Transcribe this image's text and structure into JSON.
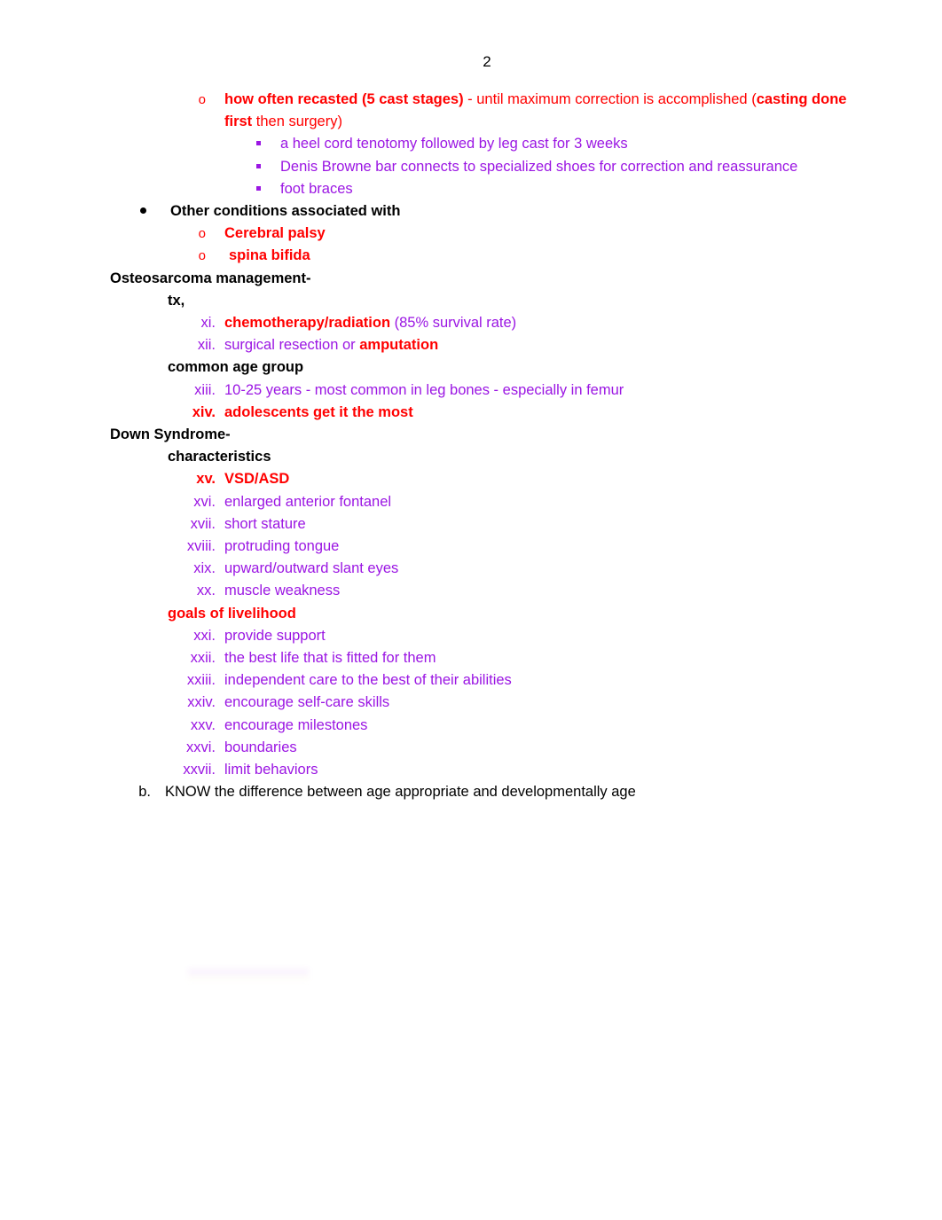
{
  "document": {
    "page_number": "2",
    "colors": {
      "red": "#ff0000",
      "purple": "#9b16e3",
      "black": "#000000"
    }
  },
  "markers": {
    "circle": "o",
    "letter_b": "b."
  },
  "blocks": {
    "recast": {
      "marker": "o",
      "bold_lead": "how often recasted (5 cast stages)",
      "mid": " - until maximum correction is accomplished (",
      "bold_tail": "casting done first",
      "end": " then surgery)"
    },
    "recast_sub": [
      {
        "text": "a heel cord tenotomy followed by leg cast for 3 weeks"
      },
      {
        "text": "Denis Browne bar connects to specialized shoes for correction and reassurance"
      },
      {
        "text": "foot braces"
      }
    ],
    "other_conditions": {
      "heading": "Other conditions associated with",
      "items": [
        {
          "marker": "o",
          "text": "Cerebral palsy"
        },
        {
          "marker": "o",
          "text": "spina bifida"
        }
      ]
    },
    "osteosarcoma": {
      "heading": "Osteosarcoma management-",
      "subhead_tx": "tx,",
      "tx_items": [
        {
          "numeral": "xi.",
          "bold_part": "chemotherapy/radiation",
          "plain_part": " (85% survival rate)"
        },
        {
          "numeral": "xii.",
          "plain_lead": "surgical resection or ",
          "bold_tail": "amputation"
        }
      ],
      "subhead_age": "common age group",
      "age_items": [
        {
          "numeral": "xiii.",
          "text": "10-25 years - most common in leg bones - especially in femur",
          "style": "purple"
        },
        {
          "numeral": "xiv.",
          "text": "adolescents get it the most",
          "style": "red-bold"
        }
      ]
    },
    "down_syndrome": {
      "heading": "Down Syndrome-",
      "subhead_characteristics": "characteristics",
      "characteristics": [
        {
          "numeral": "xv.",
          "text": "VSD/ASD",
          "style": "red-bold"
        },
        {
          "numeral": "xvi.",
          "text": "enlarged anterior fontanel",
          "style": "purple"
        },
        {
          "numeral": "xvii.",
          "text": "short stature",
          "style": "purple"
        },
        {
          "numeral": "xviii.",
          "text": "protruding tongue",
          "style": "purple"
        },
        {
          "numeral": "xix.",
          "text": "upward/outward slant eyes",
          "style": "purple"
        },
        {
          "numeral": "xx.",
          "text": "muscle weakness",
          "style": "purple"
        }
      ],
      "subhead_goals": "goals of livelihood",
      "goals": [
        {
          "numeral": "xxi.",
          "text": "provide support",
          "style": "purple"
        },
        {
          "numeral": "xxii.",
          "text": "the best life that is fitted for them",
          "style": "purple"
        },
        {
          "numeral": "xxiii.",
          "text": "independent care to the best of their abilities",
          "style": "purple"
        },
        {
          "numeral": "xxiv.",
          "text": "encourage self-care skills",
          "style": "purple"
        },
        {
          "numeral": "xxv.",
          "text": "encourage milestones",
          "style": "purple"
        },
        {
          "numeral": "xxvi.",
          "text": "boundaries",
          "style": "purple"
        },
        {
          "numeral": "xxvii.",
          "text": "limit behaviors",
          "style": "purple"
        }
      ]
    },
    "closing": {
      "marker": "b.",
      "text": "KNOW the difference between age appropriate and developmentally age"
    }
  }
}
